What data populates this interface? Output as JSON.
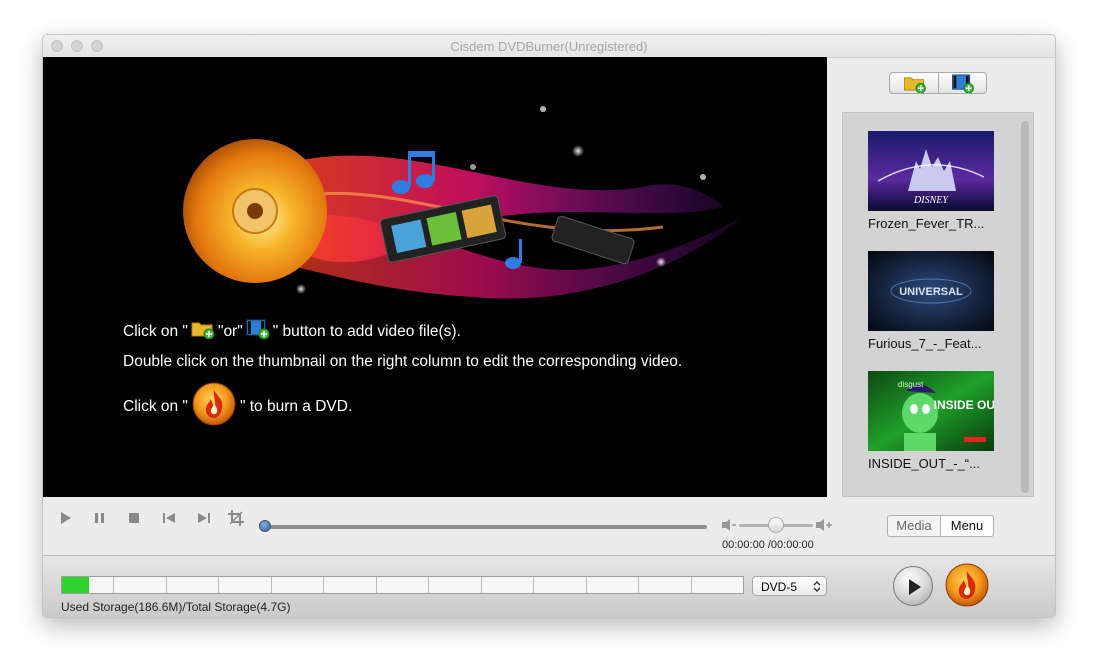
{
  "window": {
    "title": "Cisdem DVDBurner(Unregistered)"
  },
  "preview": {
    "line1_prefix": "Click on \"",
    "line1_mid": "\"or\"",
    "line1_suffix": "\" button to add video file(s).",
    "line2": "Double click on the thumbnail on the right column to edit the corresponding video.",
    "line3_prefix": "Click on  \"",
    "line3_suffix": "\"  to burn a DVD."
  },
  "media": {
    "items": [
      {
        "label": "Frozen_Fever_TR...",
        "thumb_text": "DISNEY"
      },
      {
        "label": "Furious_7_-_Feat...",
        "thumb_text": "UNIVERSAL"
      },
      {
        "label": "INSIDE_OUT_-_“...",
        "thumb_text": "INSIDE OUT",
        "thumb_subtext": "disgust"
      }
    ]
  },
  "player": {
    "time": "00:00:00 /00:00:00",
    "progress": 0,
    "volume": 0.5
  },
  "tabs": {
    "media": "Media",
    "menu": "Menu",
    "active": "Menu"
  },
  "storage": {
    "label": "Used Storage(186.6M)/Total Storage(4.7G)",
    "used_fraction": 0.04,
    "disc_type": "DVD-5"
  },
  "icons": {
    "add_folder": "add-folder-icon",
    "add_video": "add-video-icon",
    "burn": "burn-flame-icon",
    "play": "play-icon",
    "pause": "pause-icon",
    "stop": "stop-icon",
    "previous": "previous-icon",
    "next": "next-icon",
    "crop": "crop-icon",
    "volume_down": "volume-down-icon",
    "volume_up": "volume-up-icon"
  },
  "colors": {
    "storage_fill": "#2ed12e",
    "burn_orange": "#f08a1c",
    "accent_blue": "#2b5fa5"
  }
}
